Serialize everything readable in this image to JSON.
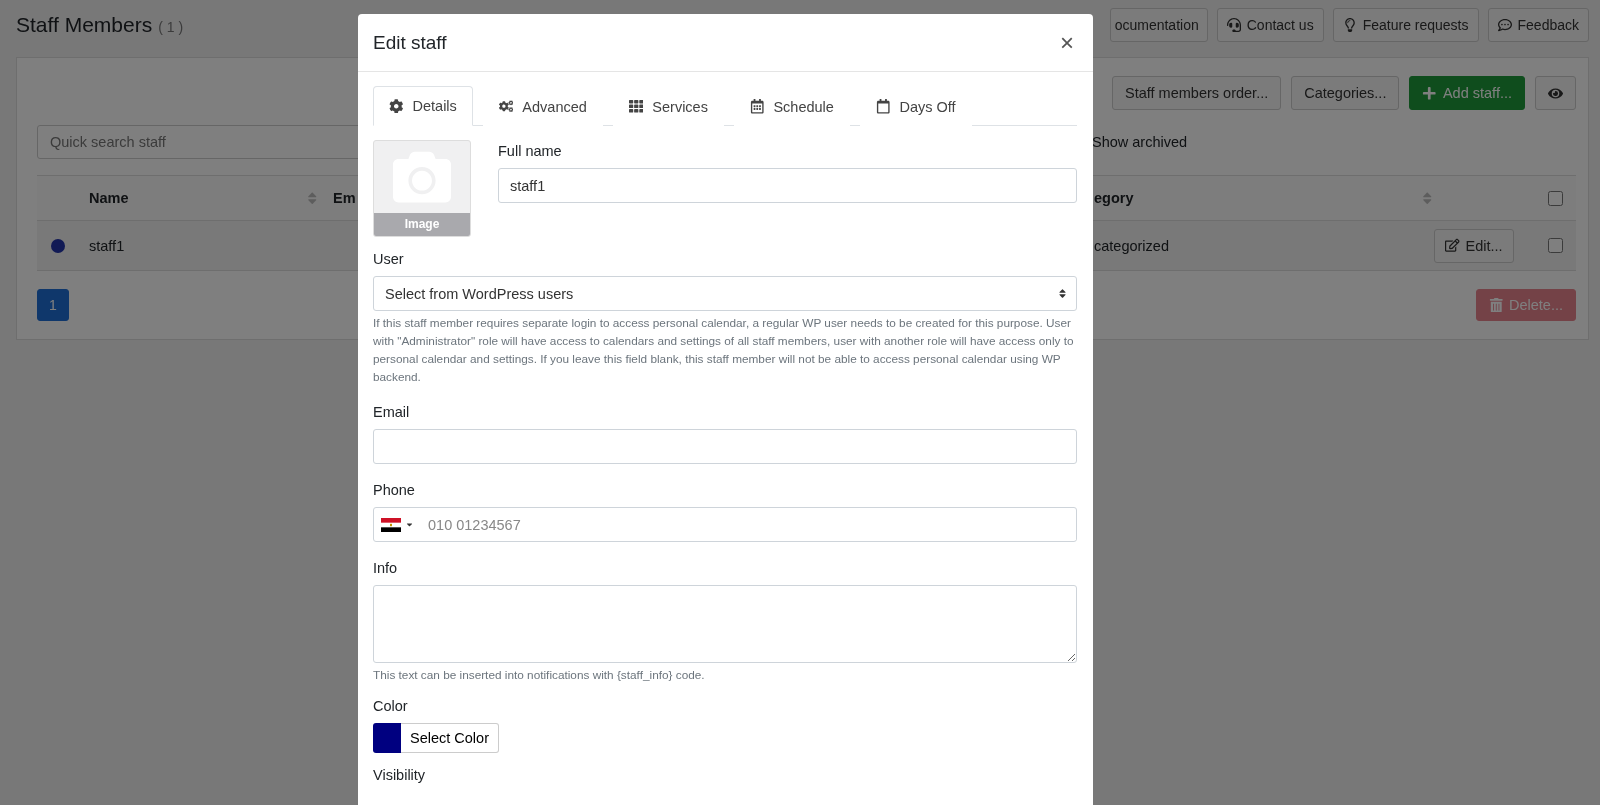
{
  "page": {
    "title": "Staff Members",
    "count": "( 1 )"
  },
  "top_links": [
    {
      "kind": "plain",
      "label": "ocumentation"
    },
    {
      "kind": "headset",
      "label": "Contact us"
    },
    {
      "kind": "bulb",
      "label": "Feature requests"
    },
    {
      "kind": "comment",
      "label": "Feedback"
    }
  ],
  "toolbar": [
    {
      "kind": "default",
      "label": "Staff members order..."
    },
    {
      "kind": "default",
      "label": "Categories..."
    },
    {
      "kind": "success",
      "label": "Add staff..."
    },
    {
      "kind": "eye"
    }
  ],
  "search": {
    "placeholder": "Quick search staff"
  },
  "show_archived": {
    "label": "Show archived"
  },
  "table": {
    "columns": [
      "Name",
      "Em",
      "egory"
    ],
    "select_all": {
      "checked": false
    },
    "rows": [
      {
        "color": "#111a55",
        "name": "staff1",
        "category": "categorized",
        "edit": "Edit...",
        "checked": false
      }
    ]
  },
  "pagination": [
    {
      "label": "1",
      "selected": true
    }
  ],
  "delete_button": {
    "label": "Delete...",
    "disabled": true
  },
  "modal": {
    "title": "Edit staff",
    "close": "×",
    "tabs": [
      {
        "kind": "gear",
        "label": "Details",
        "selected": true
      },
      {
        "kind": "gears",
        "label": "Advanced",
        "selected": false
      },
      {
        "kind": "grid",
        "label": "Services",
        "selected": false
      },
      {
        "kind": "calendar",
        "label": "Schedule",
        "selected": false
      },
      {
        "kind": "calendar-empty",
        "label": "Days Off",
        "selected": false
      }
    ],
    "image": {
      "label": "Image"
    },
    "full_name": {
      "label": "Full name",
      "value": "staff1"
    },
    "user": {
      "label": "User",
      "value": "Select from WordPress users",
      "help": "If this staff member requires separate login to access personal calendar, a regular WP user needs to be created for this purpose. User with \"Administrator\" role will have access to calendars and settings of all staff members, user with another role will have access only to personal calendar and settings. If you leave this field blank, this staff member will not be able to access personal calendar using WP backend."
    },
    "email": {
      "label": "Email"
    },
    "phone": {
      "label": "Phone",
      "placeholder": "010 01234567"
    },
    "info": {
      "label": "Info",
      "help": "This text can be inserted into notifications with {staff_info} code."
    },
    "color_picker": {
      "label": "Color",
      "color": "#000080",
      "button": "Select Color"
    },
    "visibility": {
      "label": "Visibility"
    }
  }
}
